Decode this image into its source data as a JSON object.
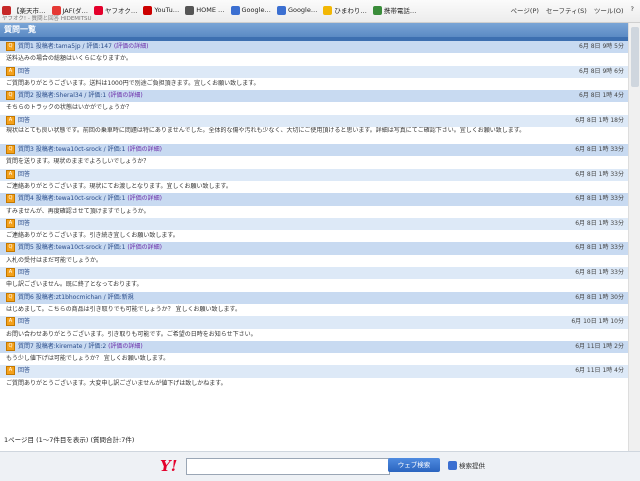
{
  "toolbar": {
    "bookmarks": [
      {
        "label": "【楽天市…",
        "color": "#c62828"
      },
      {
        "label": "JAF(ダ…",
        "color": "#e53935"
      },
      {
        "label": "ヤフオク…",
        "color": "#e4002b"
      },
      {
        "label": "YouTu…",
        "color": "#cc0000"
      },
      {
        "label": "HOME …",
        "color": "#555555"
      },
      {
        "label": "Google…",
        "color": "#3b6fd1"
      },
      {
        "label": "Google…",
        "color": "#3b6fd1"
      },
      {
        "label": "ひまわり…",
        "color": "#f2b705"
      },
      {
        "label": "携帯電話…",
        "color": "#3a8c3a"
      }
    ],
    "right_items": [
      "ページ(P)",
      "セーフティ(S)",
      "ツール(O)",
      "?"
    ],
    "crumb": "ヤフオク! - 質問と回答 HIDEMITSU"
  },
  "section_title": "質問一覧",
  "rows": [
    {
      "kind": "q",
      "head": "質問1 投稿者:tama5jp / 評価:147 ",
      "link": "(評価の詳細)",
      "date": "6月 8日 9時 5分"
    },
    {
      "kind": "b",
      "text": "送料込みの場合の総額はいくらになりますか。"
    },
    {
      "kind": "a",
      "head": "回答",
      "date": "6月 8日 9時 6分",
      "mark": true
    },
    {
      "kind": "b",
      "text": "ご質問ありがとうございます。送料は1000円で別途ご負担頂きます。宜しくお願い致します。"
    },
    {
      "kind": "q",
      "head": "質問2 投稿者:Sheral34 / 評価:1 ",
      "link": "(評価の詳細)",
      "date": "6月 8日 1時 4分"
    },
    {
      "kind": "b",
      "text": "そちらのトラックの状態はいかがでしょうか？"
    },
    {
      "kind": "a",
      "head": "回答",
      "date": "6月 8日 1時 18分",
      "mark": true
    },
    {
      "kind": "b2",
      "text": "現状はとても良い状態です。前回の乗車時に問題は特にありませんでした。全体的な傷や汚れも少なく、大切にご使用頂けると思います。詳細は写真にてご確認下さい。宜しくお願い致します。"
    },
    {
      "kind": "q",
      "head": "質問3 投稿者:tewa10ct-srock / 評価:1 ",
      "link": "(評価の詳細)",
      "date": "6月 8日 1時 33分"
    },
    {
      "kind": "b",
      "text": "質問を送ります。現状のままでよろしいでしょうか？"
    },
    {
      "kind": "a",
      "head": "回答",
      "date": "6月 8日 1時 33分",
      "mark": true
    },
    {
      "kind": "b",
      "text": "ご連絡ありがとうございます。現状にてお渡しとなります。宜しくお願い致します。"
    },
    {
      "kind": "q",
      "head": "質問4 投稿者:tewa10ct-srock / 評価:1 ",
      "link": "(評価の詳細)",
      "date": "6月 8日 1時 33分"
    },
    {
      "kind": "b",
      "text": "すみませんが、再度確認させて頂けますでしょうか。"
    },
    {
      "kind": "a",
      "head": "回答",
      "date": "6月 8日 1時 33分",
      "mark": true
    },
    {
      "kind": "b",
      "text": "ご連絡ありがとうございます。引き続き宜しくお願い致します。"
    },
    {
      "kind": "q",
      "head": "質問5 投稿者:tewa10ct-srock / 評価:1 ",
      "link": "(評価の詳細)",
      "date": "6月 8日 1時 33分"
    },
    {
      "kind": "b",
      "text": "入札の受付はまだ可能でしょうか。"
    },
    {
      "kind": "a",
      "head": "回答",
      "date": "6月 8日 1時 33分",
      "mark": true
    },
    {
      "kind": "b",
      "text": "申し訳ございません。既に終了となっております。"
    },
    {
      "kind": "q",
      "head": "質問6 投稿者:zt1bhocmichan / 評価:新規",
      "date": "6月 8日 1時 30分"
    },
    {
      "kind": "b",
      "text": "はじめまして。こちらの商品は引き取りでも可能でしょうか？ 宜しくお願い致します。"
    },
    {
      "kind": "a",
      "head": "回答",
      "date": "6月 10日 1時 10分",
      "mark": true
    },
    {
      "kind": "b",
      "text": "お問い合わせありがとうございます。引き取りも可能です。ご希望の日時をお知らせ下さい。"
    },
    {
      "kind": "q",
      "head": "質問7 投稿者:kiremate / 評価:2 ",
      "link": "(評価の詳細)",
      "date": "6月 11日 1時 2分"
    },
    {
      "kind": "b",
      "text": "もう少し値下げは可能でしょうか？ 宜しくお願い致します。"
    },
    {
      "kind": "a",
      "head": "回答",
      "date": "6月 11日 1時 4分",
      "mark": true
    },
    {
      "kind": "b",
      "text": "ご質問ありがとうございます。大変申し訳ございませんが値下げは致しかねます。"
    }
  ],
  "total_text": "1ページ目 (1～7件目を表示) (質問合計:7件)",
  "search": {
    "logo": "Y!",
    "placeholder": "",
    "button": "ウェブ検索",
    "extra": "検索提供"
  }
}
